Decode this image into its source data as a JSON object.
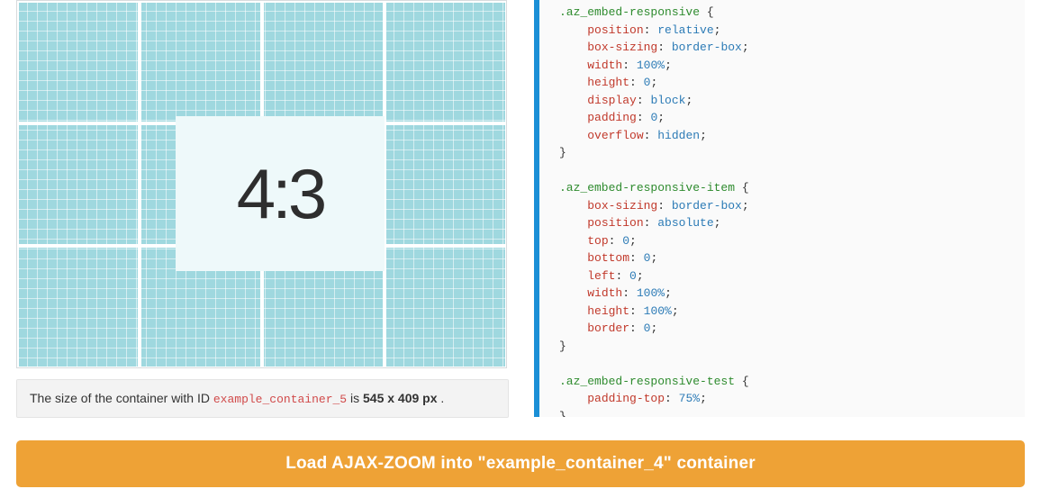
{
  "preview": {
    "ratio_label": "4:3"
  },
  "caption": {
    "prefix": "The size of the container with ID ",
    "container_id": "example_container_5",
    "middle": " is ",
    "dimensions": "545 x 409 px",
    "suffix": "."
  },
  "code": {
    "rules": [
      {
        "selector": ".az_embed-responsive",
        "declarations": [
          {
            "prop": "position",
            "value": "relative"
          },
          {
            "prop": "box-sizing",
            "value": "border-box"
          },
          {
            "prop": "width",
            "value": "100%"
          },
          {
            "prop": "height",
            "value": "0"
          },
          {
            "prop": "display",
            "value": "block"
          },
          {
            "prop": "padding",
            "value": "0"
          },
          {
            "prop": "overflow",
            "value": "hidden"
          }
        ]
      },
      {
        "selector": ".az_embed-responsive-item",
        "declarations": [
          {
            "prop": "box-sizing",
            "value": "border-box"
          },
          {
            "prop": "position",
            "value": "absolute"
          },
          {
            "prop": "top",
            "value": "0"
          },
          {
            "prop": "bottom",
            "value": "0"
          },
          {
            "prop": "left",
            "value": "0"
          },
          {
            "prop": "width",
            "value": "100%"
          },
          {
            "prop": "height",
            "value": "100%"
          },
          {
            "prop": "border",
            "value": "0"
          }
        ]
      },
      {
        "selector": ".az_embed-responsive-test",
        "declarations": [
          {
            "prop": "padding-top",
            "value": "75%"
          }
        ],
        "truncated": true
      }
    ]
  },
  "button": {
    "label": "Load AJAX-ZOOM into \"example_container_4\" container"
  }
}
